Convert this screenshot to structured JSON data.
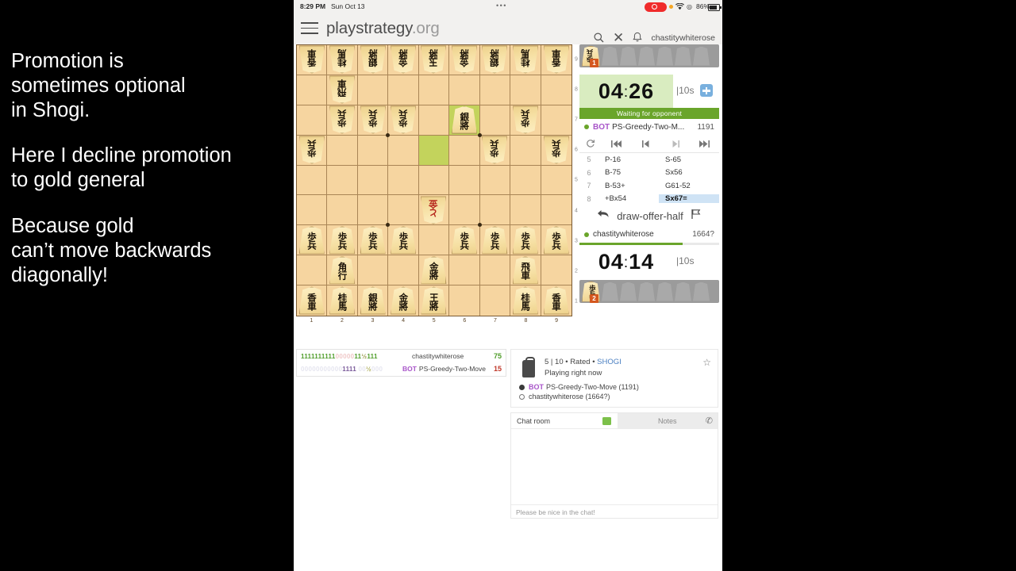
{
  "caption": {
    "paragraphs": [
      "Promotion is\nsometimes optional\nin Shogi.",
      "Here I decline promotion\nto gold general",
      "Because gold\ncan’t move backwards\ndiagonally!"
    ]
  },
  "statusbar": {
    "time": "8:29 PM",
    "date": "Sun Oct 13",
    "dots": "•••",
    "battery_text": "86%",
    "location_glyph": "◎"
  },
  "header": {
    "brand_name": "playstrategy",
    "brand_tld": ".org",
    "username": "chastitywhiterose"
  },
  "board": {
    "file_labels": [
      "1",
      "2",
      "3",
      "4",
      "5",
      "6",
      "7",
      "8",
      "9"
    ],
    "rank_labels": [
      "9",
      "8",
      "7",
      "6",
      "5",
      "4",
      "3",
      "2",
      "1"
    ],
    "highlight_squares": [
      "r3c6",
      "r4c5"
    ],
    "dot_marks": [
      "r3c3",
      "r3c6",
      "r6c3",
      "r6c6"
    ],
    "pieces": [
      {
        "sq": "r1c1",
        "glyph": "香車",
        "side": "gote"
      },
      {
        "sq": "r1c2",
        "glyph": "桂馬",
        "side": "gote"
      },
      {
        "sq": "r1c3",
        "glyph": "銀將",
        "side": "gote"
      },
      {
        "sq": "r1c4",
        "glyph": "金將",
        "side": "gote"
      },
      {
        "sq": "r1c5",
        "glyph": "玉將",
        "side": "gote"
      },
      {
        "sq": "r1c6",
        "glyph": "金將",
        "side": "gote"
      },
      {
        "sq": "r1c7",
        "glyph": "銀將",
        "side": "gote"
      },
      {
        "sq": "r1c8",
        "glyph": "桂馬",
        "side": "gote"
      },
      {
        "sq": "r1c9",
        "glyph": "香車",
        "side": "gote"
      },
      {
        "sq": "r2c2",
        "glyph": "飛車",
        "side": "gote"
      },
      {
        "sq": "r3c2",
        "glyph": "歩兵",
        "side": "gote"
      },
      {
        "sq": "r3c3",
        "glyph": "歩兵",
        "side": "gote"
      },
      {
        "sq": "r3c4",
        "glyph": "歩兵",
        "side": "gote"
      },
      {
        "sq": "r3c6",
        "glyph": "銀將",
        "side": "sente"
      },
      {
        "sq": "r3c8",
        "glyph": "歩兵",
        "side": "gote"
      },
      {
        "sq": "r4c1",
        "glyph": "歩兵",
        "side": "gote"
      },
      {
        "sq": "r4c7",
        "glyph": "歩兵",
        "side": "gote"
      },
      {
        "sq": "r4c9",
        "glyph": "歩兵",
        "side": "gote"
      },
      {
        "sq": "r6c5",
        "glyph": "と金",
        "side": "gote",
        "promoted": true
      },
      {
        "sq": "r7c1",
        "glyph": "歩兵",
        "side": "sente"
      },
      {
        "sq": "r7c2",
        "glyph": "歩兵",
        "side": "sente"
      },
      {
        "sq": "r7c3",
        "glyph": "歩兵",
        "side": "sente"
      },
      {
        "sq": "r7c4",
        "glyph": "歩兵",
        "side": "sente"
      },
      {
        "sq": "r7c6",
        "glyph": "歩兵",
        "side": "sente"
      },
      {
        "sq": "r7c7",
        "glyph": "歩兵",
        "side": "sente"
      },
      {
        "sq": "r7c8",
        "glyph": "歩兵",
        "side": "sente"
      },
      {
        "sq": "r7c9",
        "glyph": "歩兵",
        "side": "sente"
      },
      {
        "sq": "r8c2",
        "glyph": "角行",
        "side": "sente"
      },
      {
        "sq": "r8c5",
        "glyph": "金將",
        "side": "sente"
      },
      {
        "sq": "r8c8",
        "glyph": "飛車",
        "side": "sente"
      },
      {
        "sq": "r9c1",
        "glyph": "香車",
        "side": "sente"
      },
      {
        "sq": "r9c2",
        "glyph": "桂馬",
        "side": "sente"
      },
      {
        "sq": "r9c3",
        "glyph": "銀將",
        "side": "sente"
      },
      {
        "sq": "r9c4",
        "glyph": "金將",
        "side": "sente"
      },
      {
        "sq": "r9c5",
        "glyph": "王將",
        "side": "sente"
      },
      {
        "sq": "r9c8",
        "glyph": "桂馬",
        "side": "sente"
      },
      {
        "sq": "r9c9",
        "glyph": "香車",
        "side": "sente"
      }
    ]
  },
  "trays": {
    "top": {
      "held_glyph": "歩兵",
      "count": "1",
      "empty_slots": 6
    },
    "bottom": {
      "held_glyph": "歩兵",
      "count": "2",
      "empty_slots": 6
    }
  },
  "clocks": {
    "top": {
      "minutes": "04",
      "seconds": "26",
      "increment": "|10s",
      "active": true
    },
    "bottom": {
      "minutes": "04",
      "seconds": "14",
      "increment": "|10s",
      "active": false
    },
    "plus_button": "plus-icon"
  },
  "status_banner": "Waiting for opponent",
  "opponent": {
    "badge": "BOT",
    "name": "PS-Greedy-Two-M...",
    "rating": "1191"
  },
  "me": {
    "name": "chastitywhiterose",
    "rating": "1664?"
  },
  "move_nav": [
    "flip-icon",
    "first-move-icon",
    "prev-move-icon",
    "next-move-icon",
    "last-move-icon"
  ],
  "moves": [
    {
      "num": "5",
      "white": "P-16",
      "black": "S-65",
      "current": false
    },
    {
      "num": "6",
      "white": "B-75",
      "black": "Sx56",
      "current": false
    },
    {
      "num": "7",
      "white": "B-53+",
      "black": "G61-52",
      "current": false
    },
    {
      "num": "8",
      "white": "+Bx54",
      "black": "Sx67=",
      "current": true
    }
  ],
  "actions": [
    "takeback-icon",
    "draw-offer-half",
    "resign-flag-icon"
  ],
  "score_panel": {
    "rows": [
      {
        "bits": "11111111110000011½111",
        "name": "chastitywhiterose",
        "score": "75",
        "is_bot": false
      },
      {
        "bits": "000000000001111 00½000",
        "name": "PS-Greedy-Two-Move",
        "badge": "BOT",
        "score": "15",
        "is_bot": true
      }
    ]
  },
  "game_info": {
    "meta_prefix": "5 | 10 • Rated • ",
    "variant": "SHOGI",
    "status": "Playing right now",
    "players": [
      {
        "color": "black",
        "badge": "BOT",
        "name": "PS-Greedy-Two-Move (1191)"
      },
      {
        "color": "white",
        "badge": "",
        "name": "chastitywhiterose (1664?)"
      }
    ],
    "star_icon": "star-outline-icon"
  },
  "chat": {
    "tab_active": "Chat room",
    "tab_inactive": "Notes",
    "footer_placeholder": "Please be nice in the chat!",
    "phone_icon": "phone-icon"
  }
}
